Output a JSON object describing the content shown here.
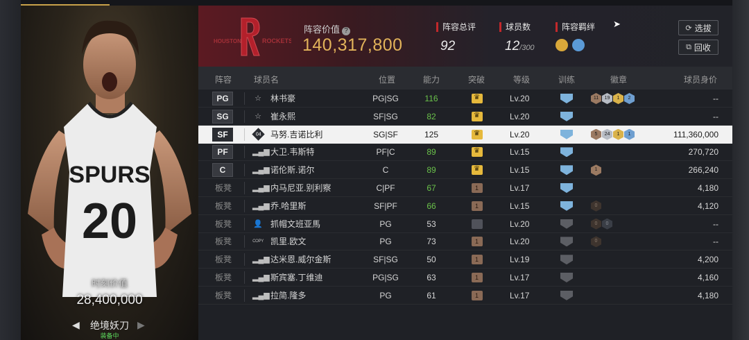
{
  "card": {
    "jersey_team": "SPURS",
    "jersey_number": "20",
    "value_label": "时刻价值",
    "value": "28,400,000",
    "skin_name": "绝境妖刀",
    "status": "装备中"
  },
  "header": {
    "team_logo_text": "HOUSTON ROCKETS",
    "lineup_value_label": "阵容价值",
    "lineup_value": "140,317,800",
    "rating_label": "阵容总评",
    "rating_value": "92",
    "player_count_label": "球员数",
    "player_count_value": "12",
    "player_count_max": "/300",
    "bond_label": "阵容羁绊",
    "select_button": "选拔",
    "recycle_button": "回收"
  },
  "columns": [
    "阵容",
    "球员名",
    "位置",
    "能力",
    "突破",
    "等级",
    "训练",
    "徽章",
    "球员身价"
  ],
  "rows": [
    {
      "slot": "PG",
      "is_starter": true,
      "type_icon": "star-icon",
      "type_glyph": "☆",
      "name": "林书豪",
      "position": "PG|SG",
      "ability": "116",
      "ability_green": true,
      "breakthrough": "gold",
      "level": "Lv.20",
      "training": "blue",
      "badges": [
        {
          "t": "br",
          "v": "11"
        },
        {
          "t": "sv",
          "v": "19"
        },
        {
          "t": "gd",
          "v": "1"
        },
        {
          "t": "bl",
          "v": "2"
        }
      ],
      "price": "--",
      "selected": false
    },
    {
      "slot": "SG",
      "is_starter": true,
      "type_icon": "star-icon",
      "type_glyph": "☆",
      "name": "崔永熙",
      "position": "SF|SG",
      "ability": "82",
      "ability_green": true,
      "breakthrough": "gold",
      "level": "Lv.20",
      "training": "blue",
      "badges": [],
      "price": "--",
      "selected": false
    },
    {
      "slot": "SF",
      "is_starter": true,
      "type_icon": "moment-icon",
      "type_glyph": "04",
      "name": "马努.吉诺比利",
      "position": "SG|SF",
      "ability": "125",
      "ability_green": false,
      "breakthrough": "gold",
      "level": "Lv.20",
      "training": "blue",
      "badges": [
        {
          "t": "br",
          "v": "5"
        },
        {
          "t": "sv",
          "v": "24"
        },
        {
          "t": "gd",
          "v": "1"
        },
        {
          "t": "bl",
          "v": "1"
        }
      ],
      "price": "111,360,000",
      "selected": true
    },
    {
      "slot": "PF",
      "is_starter": true,
      "type_icon": "signal-icon",
      "type_glyph": "▂▄▆",
      "name": "大卫.韦斯特",
      "position": "PF|C",
      "ability": "89",
      "ability_green": true,
      "breakthrough": "gold",
      "level": "Lv.15",
      "training": "blue",
      "badges": [],
      "price": "270,720",
      "selected": false
    },
    {
      "slot": "C",
      "is_starter": true,
      "type_icon": "signal-icon",
      "type_glyph": "▂▄▆",
      "name": "诺伦斯.诺尔",
      "position": "C",
      "ability": "89",
      "ability_green": true,
      "breakthrough": "gold",
      "level": "Lv.15",
      "training": "blue",
      "badges": [
        {
          "t": "br",
          "v": "1"
        }
      ],
      "price": "266,240",
      "selected": false
    },
    {
      "slot": "板凳",
      "is_starter": false,
      "type_icon": "signal-icon",
      "type_glyph": "▂▄▆",
      "name": "内马尼亚.别利察",
      "position": "C|PF",
      "ability": "67",
      "ability_green": true,
      "breakthrough": "bronze",
      "level": "Lv.17",
      "training": "blue",
      "badges": [],
      "price": "4,180",
      "selected": false
    },
    {
      "slot": "板凳",
      "is_starter": false,
      "type_icon": "signal-icon",
      "type_glyph": "▂▄▆",
      "name": "乔.哈里斯",
      "position": "SF|PF",
      "ability": "66",
      "ability_green": true,
      "breakthrough": "bronze",
      "level": "Lv.15",
      "training": "blue",
      "badges": [
        {
          "t": "dk",
          "v": "0"
        }
      ],
      "price": "4,120",
      "selected": false
    },
    {
      "slot": "板凳",
      "is_starter": false,
      "type_icon": "person-icon",
      "type_glyph": "👤",
      "name": "抓帽文班亚馬",
      "position": "PG",
      "ability": "53",
      "ability_green": false,
      "breakthrough": "dark",
      "level": "Lv.20",
      "training": "grey",
      "badges": [
        {
          "t": "dk",
          "v": "0"
        },
        {
          "t": "dg",
          "v": "0"
        }
      ],
      "price": "--",
      "selected": false
    },
    {
      "slot": "板凳",
      "is_starter": false,
      "type_icon": "copy-icon",
      "type_glyph": "COPY",
      "name": "凯里.欧文",
      "position": "PG",
      "ability": "73",
      "ability_green": false,
      "breakthrough": "bronze",
      "level": "Lv.20",
      "training": "grey",
      "badges": [
        {
          "t": "dk",
          "v": "0"
        }
      ],
      "price": "--",
      "selected": false
    },
    {
      "slot": "板凳",
      "is_starter": false,
      "type_icon": "signal-icon",
      "type_glyph": "▂▄▆",
      "name": "达米恩.威尔金斯",
      "position": "SF|SG",
      "ability": "50",
      "ability_green": false,
      "breakthrough": "bronze",
      "level": "Lv.19",
      "training": "grey",
      "badges": [],
      "price": "4,200",
      "selected": false
    },
    {
      "slot": "板凳",
      "is_starter": false,
      "type_icon": "signal-icon",
      "type_glyph": "▂▄▆",
      "name": "斯宾塞.丁维迪",
      "position": "PG|SG",
      "ability": "63",
      "ability_green": false,
      "breakthrough": "bronze",
      "level": "Lv.17",
      "training": "grey",
      "badges": [],
      "price": "4,160",
      "selected": false
    },
    {
      "slot": "板凳",
      "is_starter": false,
      "type_icon": "signal-icon",
      "type_glyph": "▂▄▆",
      "name": "拉简.隆多",
      "position": "PG",
      "ability": "61",
      "ability_green": false,
      "breakthrough": "bronze",
      "level": "Lv.17",
      "training": "grey",
      "badges": [],
      "price": "4,180",
      "selected": false
    }
  ]
}
